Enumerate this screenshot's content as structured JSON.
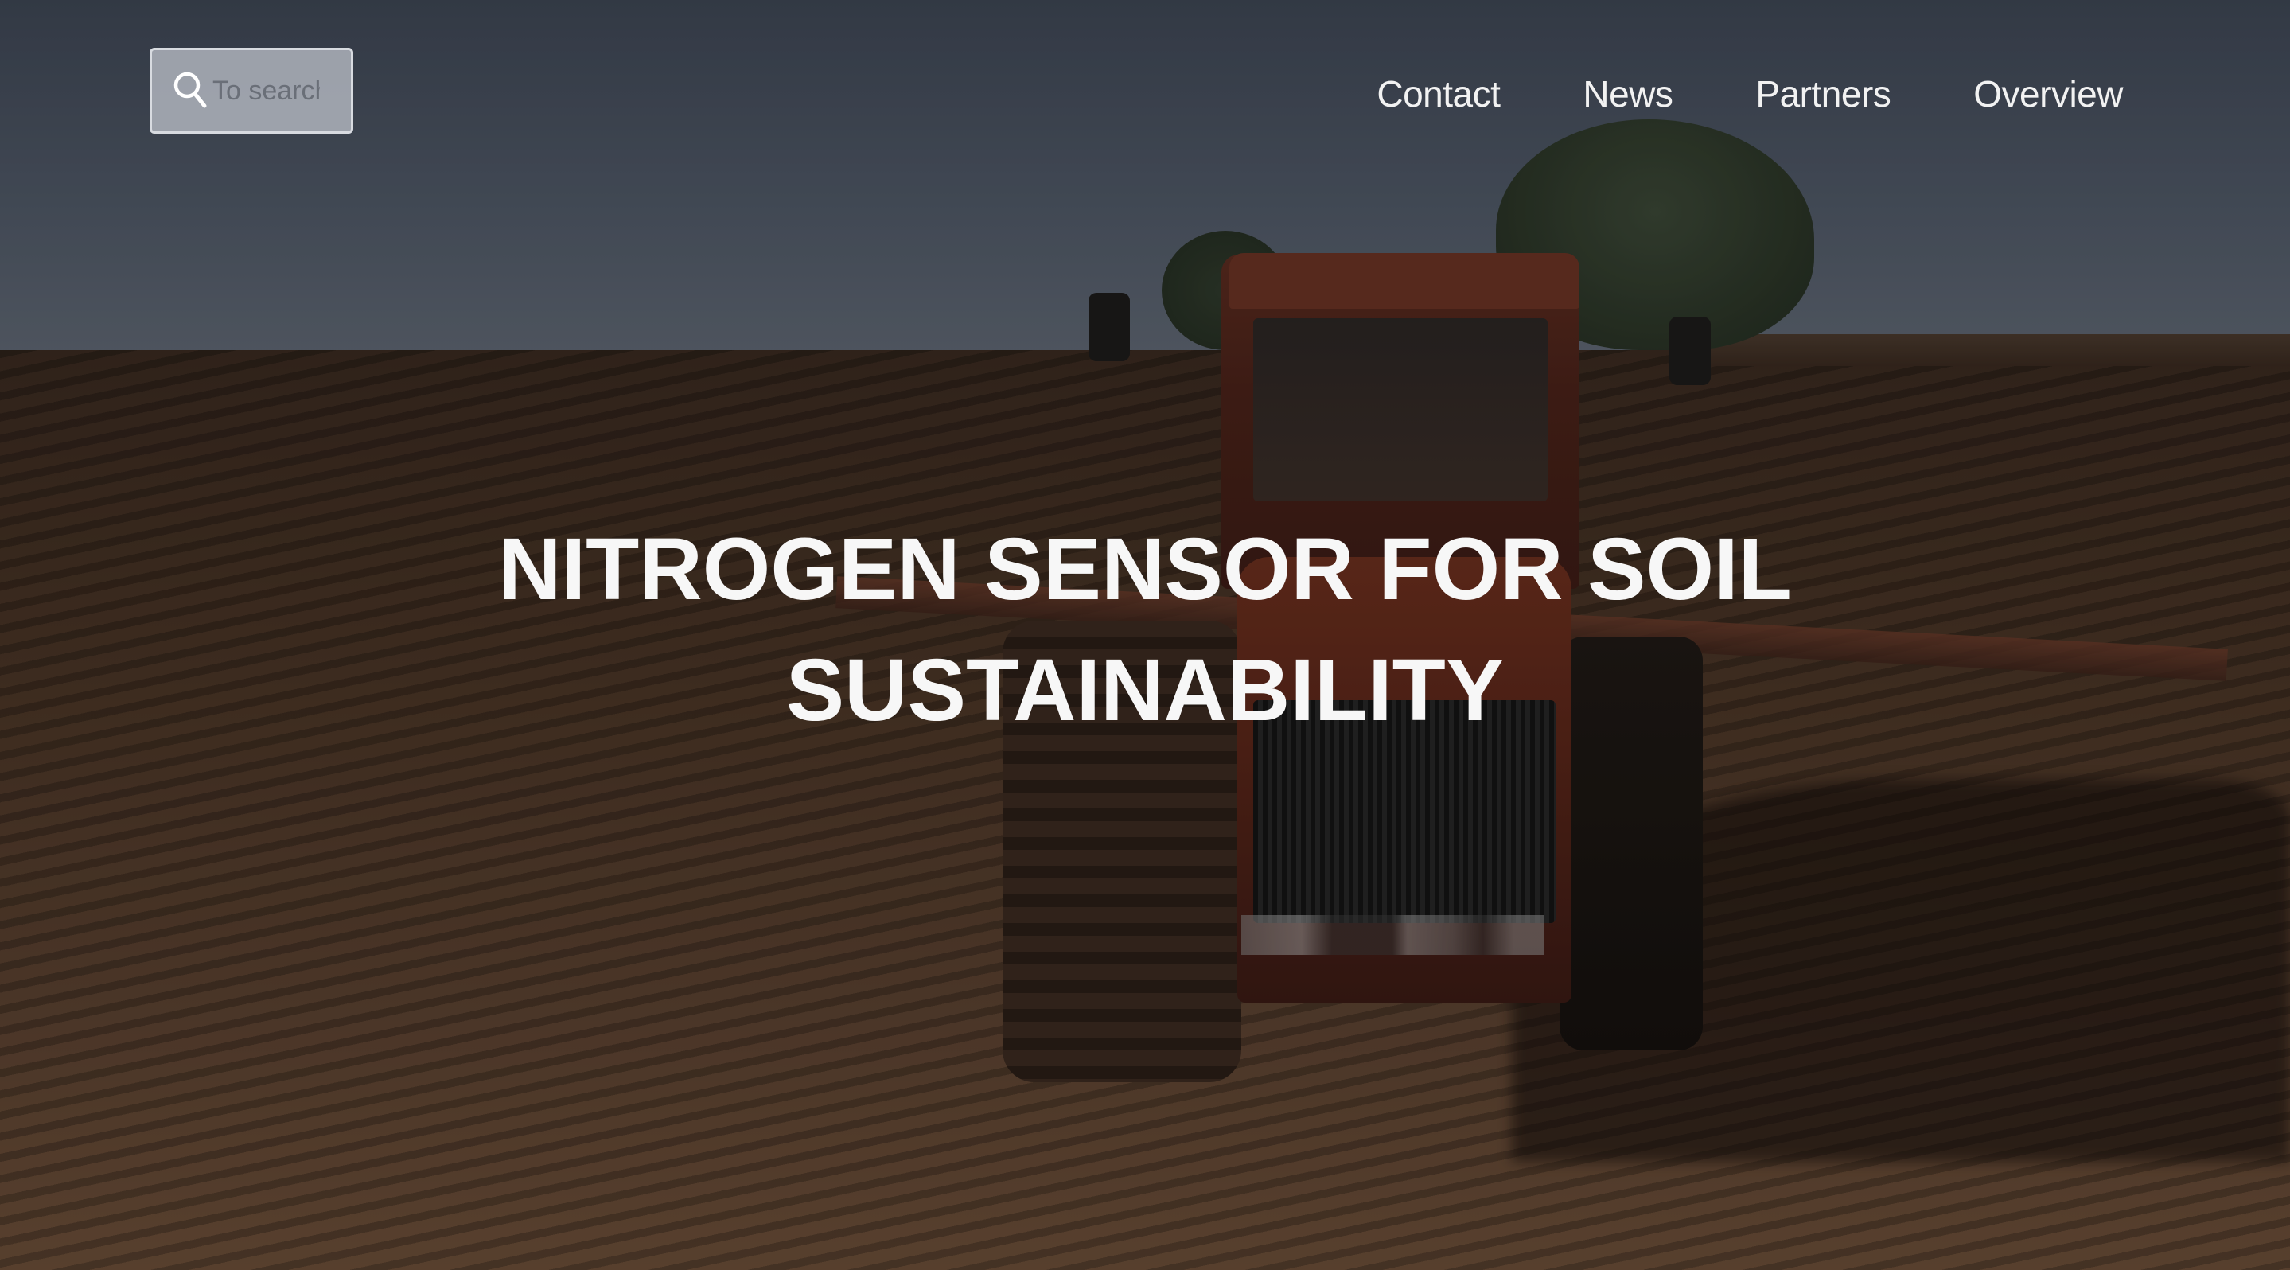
{
  "search": {
    "placeholder": "To search",
    "icon": "search-icon"
  },
  "nav": {
    "items": [
      {
        "label": "Contact"
      },
      {
        "label": "News"
      },
      {
        "label": "Partners"
      },
      {
        "label": "Overview"
      }
    ]
  },
  "hero": {
    "title_line1": "NITROGEN SENSOR FOR SOIL",
    "title_line2": "SUSTAINABILITY",
    "background": "tractor plowing a field"
  },
  "colors": {
    "text": "#f7f7f7",
    "search_bg": "#c3c8d0",
    "search_border": "#d8dbe0"
  }
}
